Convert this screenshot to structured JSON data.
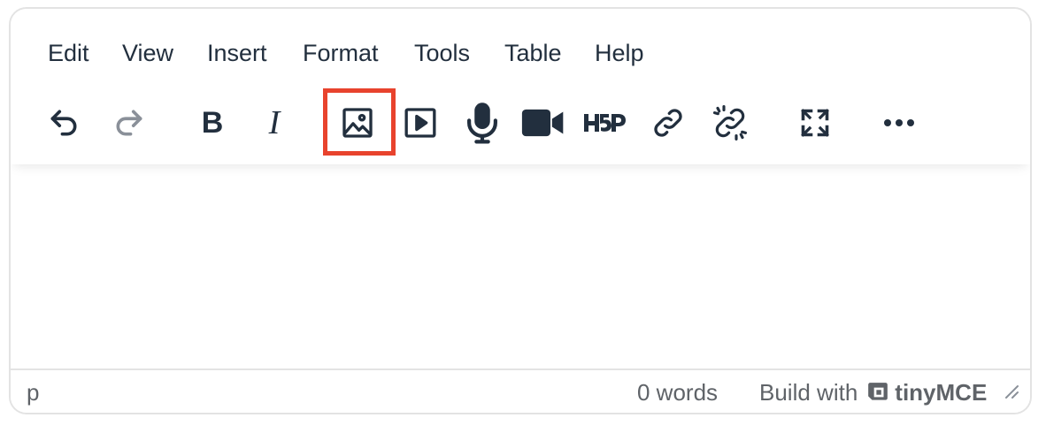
{
  "menubar": {
    "items": [
      {
        "label": "Edit"
      },
      {
        "label": "View"
      },
      {
        "label": "Insert"
      },
      {
        "label": "Format"
      },
      {
        "label": "Tools"
      },
      {
        "label": "Table"
      },
      {
        "label": "Help"
      }
    ]
  },
  "toolbar": {
    "buttons": [
      {
        "icon": "undo-icon"
      },
      {
        "icon": "redo-icon",
        "state": "disabled"
      },
      {
        "icon": "bold-icon",
        "glyph": "B"
      },
      {
        "icon": "italic-icon",
        "glyph": "I"
      },
      {
        "icon": "image-icon",
        "state": "highlighted"
      },
      {
        "icon": "embed-media-icon"
      },
      {
        "icon": "microphone-icon"
      },
      {
        "icon": "video-camera-icon"
      },
      {
        "icon": "h5p-icon"
      },
      {
        "icon": "link-icon"
      },
      {
        "icon": "unlink-icon"
      },
      {
        "icon": "fullscreen-icon"
      },
      {
        "icon": "more-icon"
      }
    ]
  },
  "statusbar": {
    "path": "p",
    "wordcount": "0 words",
    "branding_prefix": "Build with",
    "branding_name": "tinyMCE"
  },
  "colors": {
    "icon": "#222f3e",
    "icon_disabled": "#8a9099",
    "highlight": "#e8432d",
    "status_text": "#5f6368",
    "border": "#e3e3e3"
  }
}
